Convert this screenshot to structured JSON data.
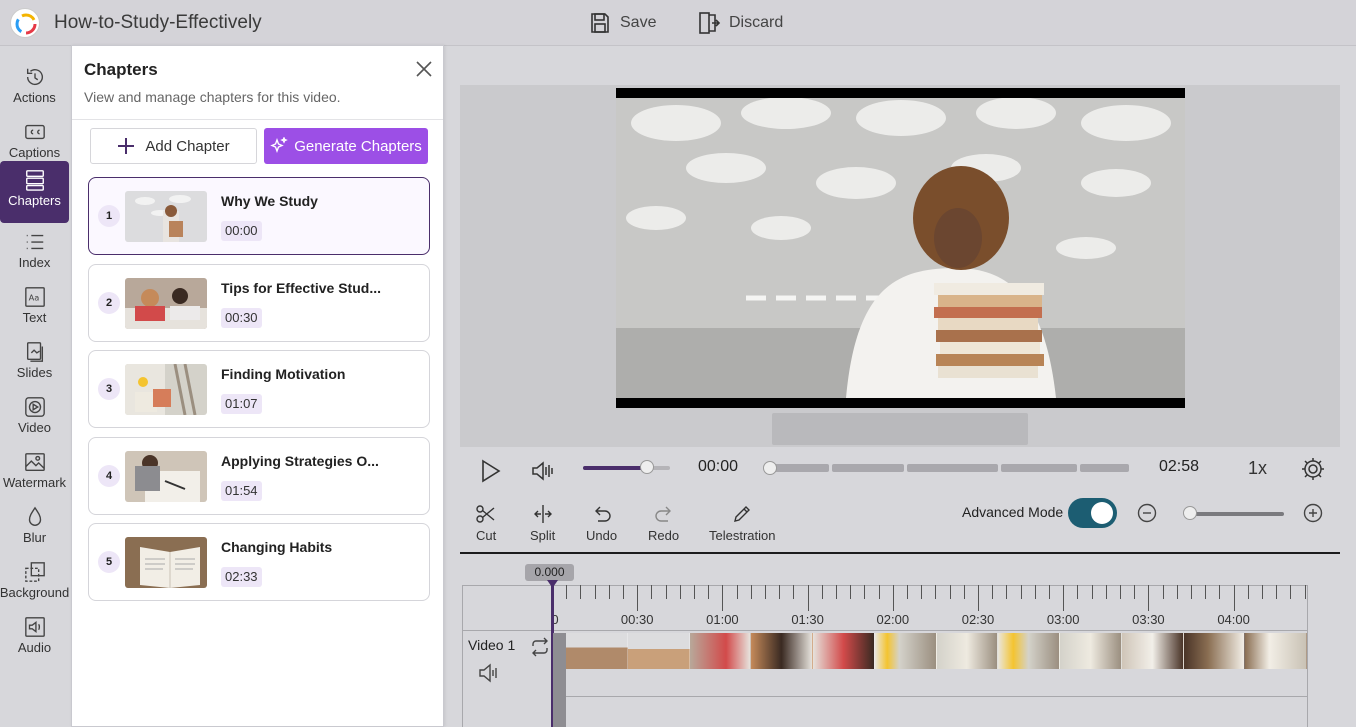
{
  "app": {
    "title": "How-to-Study-Effectively",
    "save_label": "Save",
    "discard_label": "Discard"
  },
  "rail": [
    {
      "label": "Actions",
      "icon": "actions-icon"
    },
    {
      "label": "Captions",
      "icon": "captions-icon"
    },
    {
      "label": "Chapters",
      "icon": "chapters-icon"
    },
    {
      "label": "Index",
      "icon": "index-icon"
    },
    {
      "label": "Text",
      "icon": "text-icon"
    },
    {
      "label": "Slides",
      "icon": "slides-icon"
    },
    {
      "label": "Video",
      "icon": "video-icon"
    },
    {
      "label": "Watermark",
      "icon": "watermark-icon"
    },
    {
      "label": "Blur",
      "icon": "blur-icon"
    },
    {
      "label": "Background",
      "icon": "background-icon"
    },
    {
      "label": "Audio",
      "icon": "audio-icon"
    }
  ],
  "chapters_panel": {
    "title": "Chapters",
    "subtitle": "View and manage chapters for this video.",
    "add_label": "Add Chapter",
    "generate_label": "Generate Chapters",
    "items": [
      {
        "num": "1",
        "title": "Why We Study",
        "time": "00:00"
      },
      {
        "num": "2",
        "title": "Tips for Effective Stud...",
        "time": "00:30"
      },
      {
        "num": "3",
        "title": "Finding Motivation",
        "time": "01:07"
      },
      {
        "num": "4",
        "title": "Applying Strategies O...",
        "time": "01:54"
      },
      {
        "num": "5",
        "title": "Changing Habits",
        "time": "02:33"
      }
    ]
  },
  "player": {
    "current_time": "00:00",
    "duration": "02:58",
    "speed": "1x",
    "volume_fraction": 0.74,
    "position_fraction": 0
  },
  "toolbar": {
    "cut": "Cut",
    "split": "Split",
    "undo": "Undo",
    "redo": "Redo",
    "telestration": "Telestration",
    "advanced_mode": "Advanced Mode",
    "advanced_on": true,
    "zoom_fraction": 0
  },
  "timeline": {
    "playhead": "0.000",
    "ticks": [
      "0",
      "00:30",
      "01:00",
      "01:30",
      "02:00",
      "02:30",
      "03:00",
      "03:30",
      "04:00"
    ],
    "track_name": "Video 1"
  },
  "colors": {
    "accent": "#4a2e6b",
    "generate": "#9c4fe6",
    "toggle": "#1c5d72"
  }
}
